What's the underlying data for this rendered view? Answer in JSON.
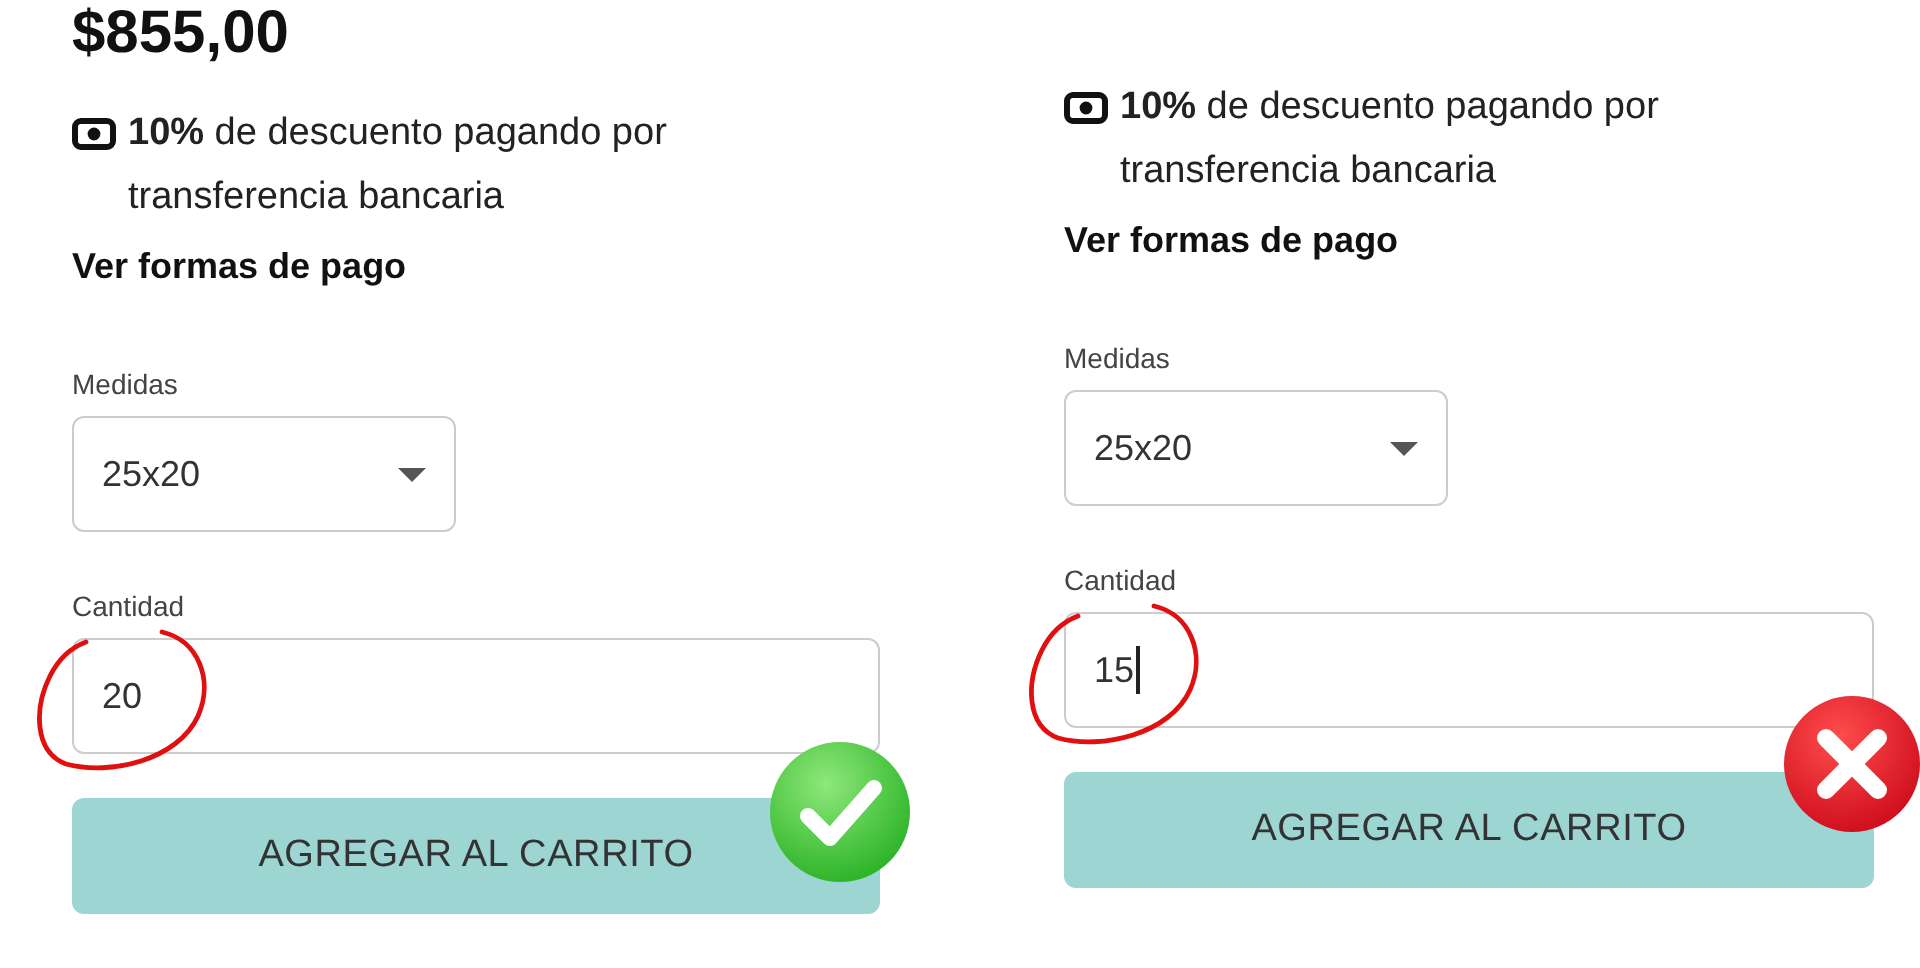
{
  "panels": [
    {
      "price": "$855,00",
      "discount": "**10%** de descuento pagando por transferencia bancaria",
      "payment_link": "Ver formas de pago",
      "size": {
        "label": "Medidas",
        "value": "25x20"
      },
      "quantity": {
        "label": "Cantidad",
        "value": "20",
        "focused": false
      },
      "button": "AGREGAR AL CARRITO",
      "verdict_icon": {
        "kind": "check"
      }
    },
    {
      "discount": "**10%** de descuento pagando por transferencia bancaria",
      "payment_link": "Ver formas de pago",
      "size": {
        "label": "Medidas",
        "value": "25x20"
      },
      "quantity": {
        "label": "Cantidad",
        "value": "15",
        "focused": true
      },
      "button": "AGREGAR AL CARRITO",
      "verdict_icon": {
        "kind": "cross"
      }
    }
  ]
}
